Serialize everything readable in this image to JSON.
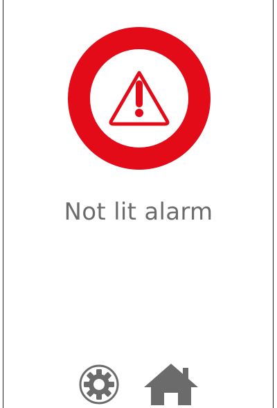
{
  "alarm": {
    "message": "Not lit alarm",
    "icon": "warning-icon",
    "ring_color": "#e30b17"
  },
  "nav": {
    "settings_icon": "gear-icon",
    "home_icon": "home-icon",
    "icon_color": "#6b6b6b"
  }
}
